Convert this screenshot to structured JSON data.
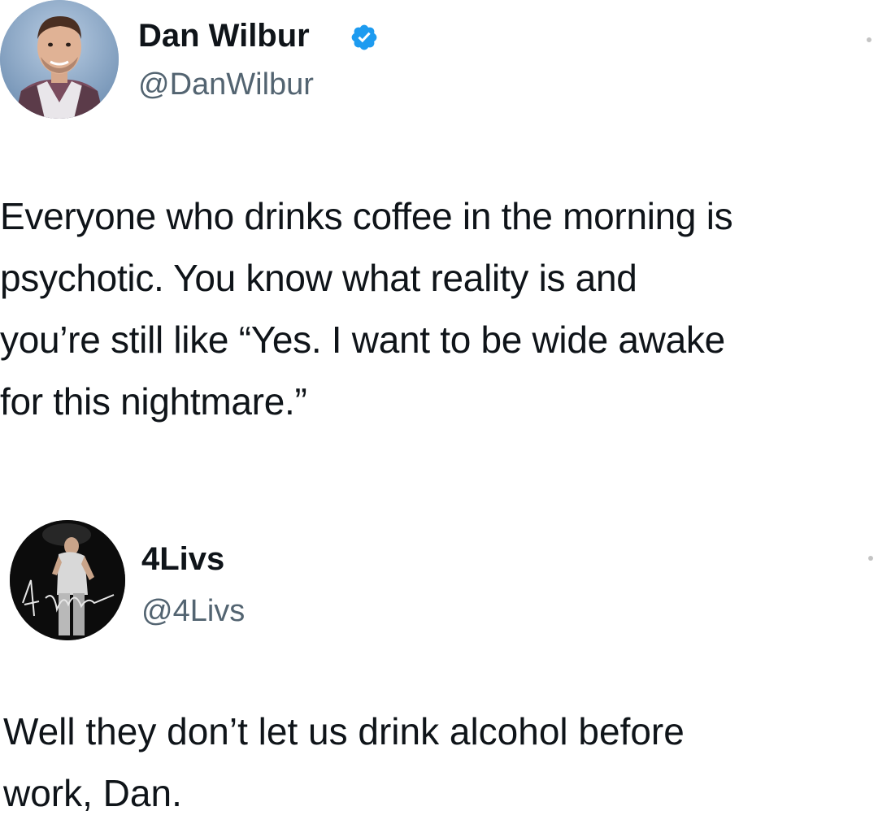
{
  "tweets": [
    {
      "author": {
        "display_name": "Dan Wilbur",
        "handle": "@DanWilbur",
        "verified": true,
        "verified_icon": "verified-badge-icon"
      },
      "text": "Everyone who drinks coffee in the morning is\npsychotic. You know what reality is and\nyou’re still like “Yes. I want to be wide awake\nfor this nightmare.”"
    },
    {
      "author": {
        "display_name": "4Livs",
        "handle": "@4Livs",
        "verified": false,
        "avatar_signature": "4Livs"
      },
      "text": "Well they don’t let us drink alcohol before\nwork, Dan."
    }
  ],
  "colors": {
    "text": "#0f1419",
    "secondary_text": "#536471",
    "verified_blue": "#1d9bf0",
    "background": "#ffffff"
  }
}
